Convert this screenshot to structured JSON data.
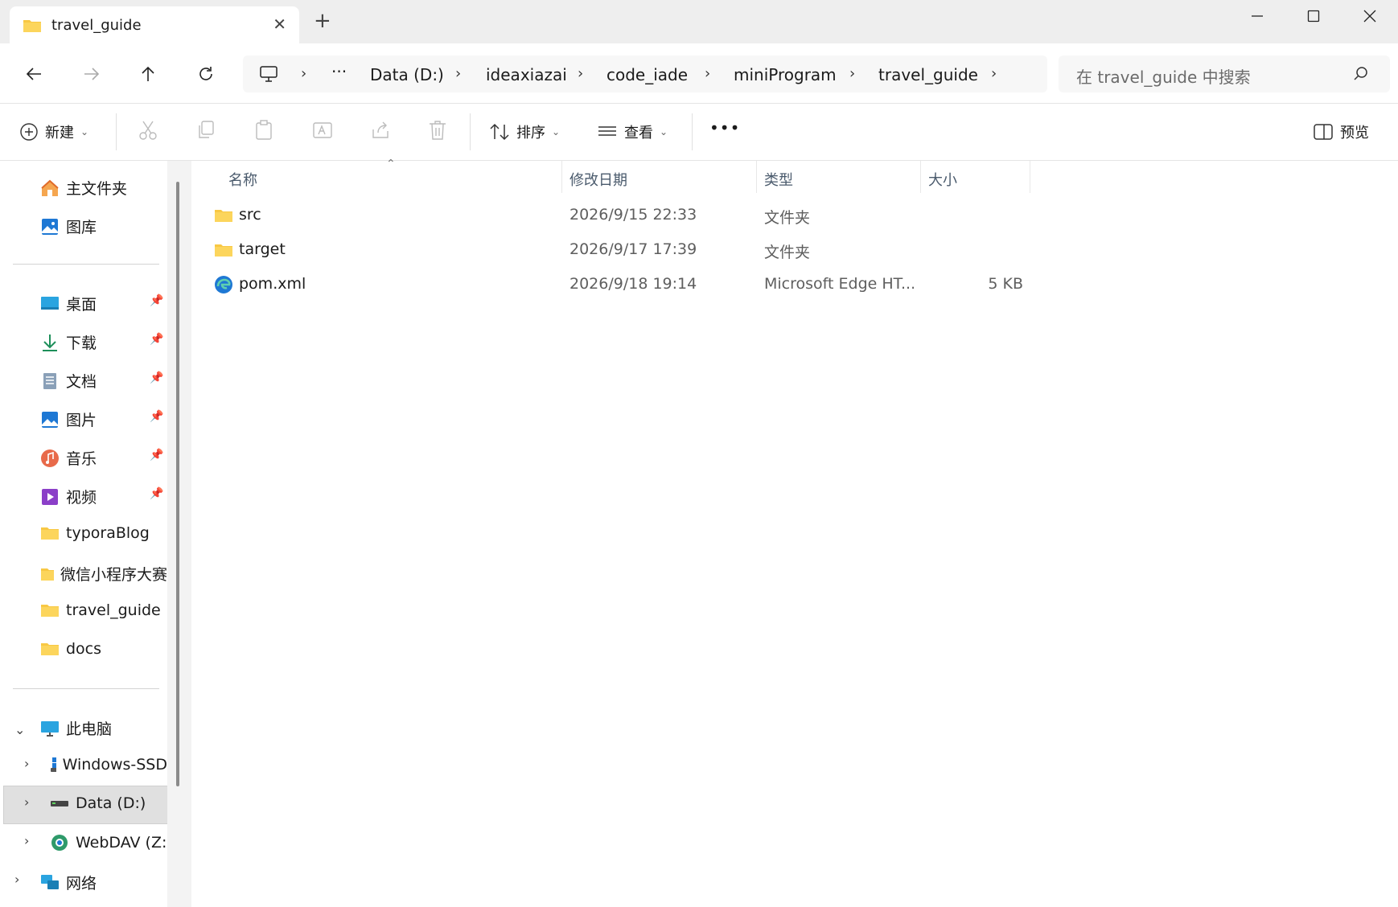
{
  "window": {
    "tab_title": "travel_guide",
    "tab_icon": "folder-icon",
    "new_tab": "+"
  },
  "breadcrumb": [
    "Data (D:)",
    "ideaxiazai",
    "code_iade",
    "miniProgram",
    "travel_guide"
  ],
  "breadcrumb_more": "···",
  "search": {
    "placeholder": "在 travel_guide 中搜索"
  },
  "toolbar": {
    "new_label": "新建",
    "sort_label": "排序",
    "view_label": "查看",
    "more_label": "•••",
    "preview_label": "预览"
  },
  "sidebar": {
    "home": "主文件夹",
    "gallery": "图库",
    "quick": [
      {
        "label": "桌面",
        "icon": "desktop-icon"
      },
      {
        "label": "下载",
        "icon": "download-icon"
      },
      {
        "label": "文档",
        "icon": "document-icon"
      },
      {
        "label": "图片",
        "icon": "picture-icon"
      },
      {
        "label": "音乐",
        "icon": "music-icon"
      },
      {
        "label": "视频",
        "icon": "video-icon"
      }
    ],
    "folders": [
      "typoraBlog",
      "微信小程序大赛",
      "travel_guide",
      "docs"
    ],
    "this_pc": "此电脑",
    "drives": [
      "Windows-SSD",
      "Data (D:)",
      "WebDAV (Z:)"
    ],
    "network": "网络"
  },
  "columns": {
    "name": "名称",
    "date": "修改日期",
    "type": "类型",
    "size": "大小"
  },
  "files": [
    {
      "name": "src",
      "date": "2026/9/15 22:33",
      "type": "文件夹",
      "size": "",
      "icon": "folder-icon"
    },
    {
      "name": "target",
      "date": "2026/9/17 17:39",
      "type": "文件夹",
      "size": "",
      "icon": "folder-icon"
    },
    {
      "name": "pom.xml",
      "date": "2026/9/18 19:14",
      "type": "Microsoft Edge HT...",
      "size": "5 KB",
      "icon": "edge-icon"
    }
  ],
  "colors": {
    "folder": "#f8c844",
    "accent": "#0067c0",
    "selected": "#e0e0e0"
  }
}
